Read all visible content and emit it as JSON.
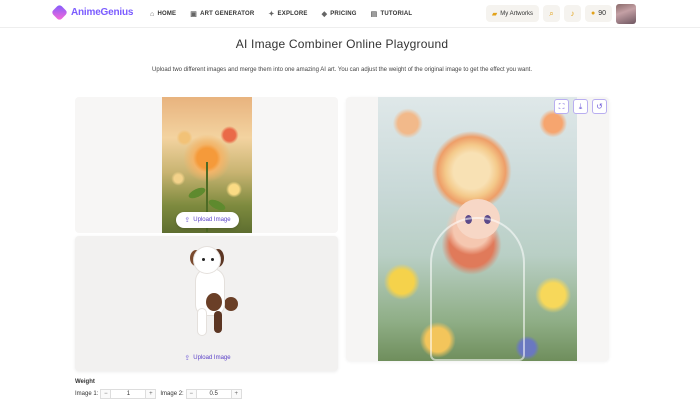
{
  "header": {
    "logo_text": "AnimeGenius",
    "nav": [
      {
        "label": "HOME",
        "icon": "home-icon",
        "glyph": "⌂"
      },
      {
        "label": "ART GENERATOR",
        "icon": "image-icon",
        "glyph": "▣"
      },
      {
        "label": "EXPLORE",
        "icon": "compass-icon",
        "glyph": "✦"
      },
      {
        "label": "PRICING",
        "icon": "diamond-icon",
        "glyph": "◆"
      },
      {
        "label": "TUTORIAL",
        "icon": "book-icon",
        "glyph": "▤"
      }
    ],
    "my_artworks": "My Artworks",
    "coins": "90"
  },
  "page": {
    "title": "AI Image Combiner Online Playground",
    "subtitle": "Upload two different images and merge them into one amazing AI art. You can adjust the weight of the original image to get the effect you want."
  },
  "upload": {
    "button_1": "Upload Image",
    "button_2": "Upload Image"
  },
  "weight": {
    "label": "Weight",
    "image1_label": "Image 1:",
    "image1_value": "1",
    "image2_label": "Image 2:",
    "image2_value": "0.5"
  },
  "colors": {
    "accent": "#7b5cff",
    "link": "#5b41c8"
  }
}
